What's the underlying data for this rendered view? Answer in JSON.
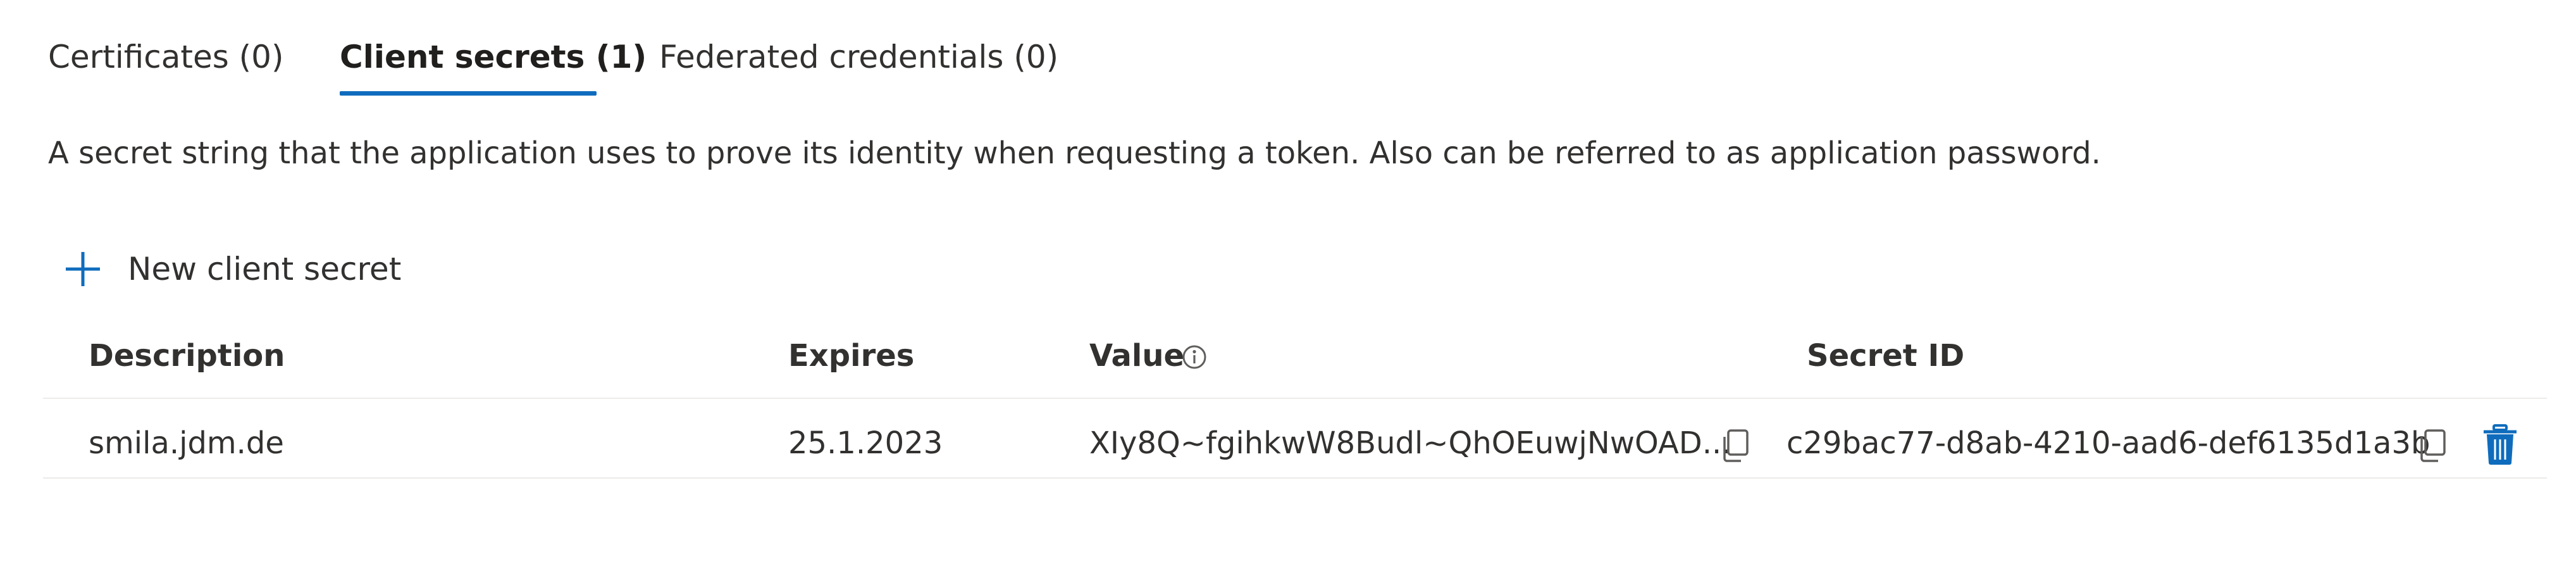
{
  "tabs": [
    {
      "label": "Certificates (0)",
      "active": false
    },
    {
      "label": "Client secrets (1)",
      "active": true
    },
    {
      "label": "Federated credentials (0)",
      "active": false
    }
  ],
  "description": "A secret string that the application uses to prove its identity when requesting a token. Also can be referred to as application password.",
  "toolbar": {
    "new_secret_label": "New client secret",
    "new_secret_icon": "plus-icon"
  },
  "table": {
    "columns": [
      "Description",
      "Expires",
      "Value",
      "Secret ID"
    ],
    "value_info_icon": "info-icon",
    "rows": [
      {
        "description": "smila.jdm.de",
        "expires": "25.1.2023",
        "value": "XIy8Q~fgihkwW8Budl~QhOEuwjNwOAD...",
        "secret_id": "c29bac77-d8ab-4210-aad6-def6135d1a3b",
        "actions": [
          "copy-icon",
          "copy-icon",
          "trash-icon"
        ]
      }
    ]
  },
  "colors": {
    "accent": "#0f6cbd",
    "text": "#323130",
    "divider": "#edebe9",
    "icon_gray": "#605e5c"
  }
}
